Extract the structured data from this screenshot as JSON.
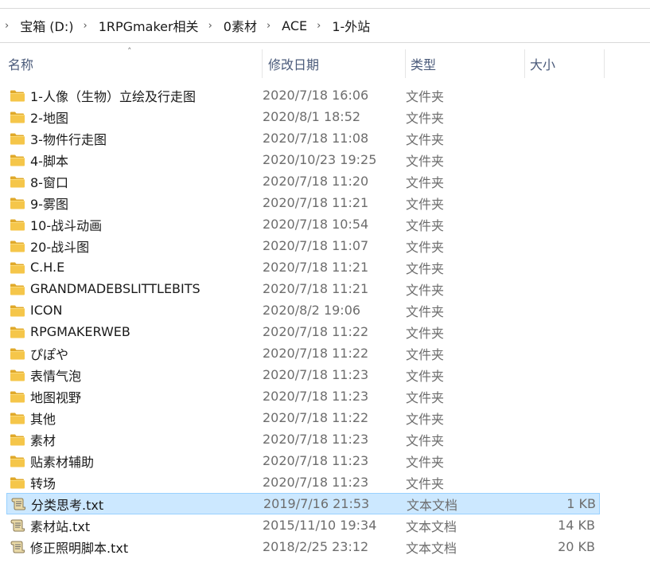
{
  "breadcrumb": {
    "items": [
      "宝箱 (D:)",
      "1RPGmaker相关",
      "0素材",
      "ACE",
      "1-外站"
    ]
  },
  "columns": {
    "name": "名称",
    "date": "修改日期",
    "type": "类型",
    "size": "大小"
  },
  "files": [
    {
      "name": "1-人像（生物）立绘及行走图",
      "date": "2020/7/18 16:06",
      "type": "文件夹",
      "size": "",
      "icon": "folder-icon"
    },
    {
      "name": "2-地图",
      "date": "2020/8/1 18:52",
      "type": "文件夹",
      "size": "",
      "icon": "folder-icon"
    },
    {
      "name": "3-物件行走图",
      "date": "2020/7/18 11:08",
      "type": "文件夹",
      "size": "",
      "icon": "folder-icon"
    },
    {
      "name": "4-脚本",
      "date": "2020/10/23 19:25",
      "type": "文件夹",
      "size": "",
      "icon": "folder-icon"
    },
    {
      "name": "8-窗口",
      "date": "2020/7/18 11:20",
      "type": "文件夹",
      "size": "",
      "icon": "folder-icon"
    },
    {
      "name": "9-雾图",
      "date": "2020/7/18 11:21",
      "type": "文件夹",
      "size": "",
      "icon": "folder-icon"
    },
    {
      "name": "10-战斗动画",
      "date": "2020/7/18 10:54",
      "type": "文件夹",
      "size": "",
      "icon": "folder-icon"
    },
    {
      "name": "20-战斗图",
      "date": "2020/7/18 11:07",
      "type": "文件夹",
      "size": "",
      "icon": "folder-icon"
    },
    {
      "name": "C.H.E",
      "date": "2020/7/18 11:21",
      "type": "文件夹",
      "size": "",
      "icon": "folder-icon"
    },
    {
      "name": "GRANDMADEBSLITTLEBITS",
      "date": "2020/7/18 11:21",
      "type": "文件夹",
      "size": "",
      "icon": "folder-icon"
    },
    {
      "name": "ICON",
      "date": "2020/8/2 19:06",
      "type": "文件夹",
      "size": "",
      "icon": "folder-icon"
    },
    {
      "name": "RPGMAKERWEB",
      "date": "2020/7/18 11:22",
      "type": "文件夹",
      "size": "",
      "icon": "folder-icon"
    },
    {
      "name": "ぴぽや",
      "date": "2020/7/18 11:22",
      "type": "文件夹",
      "size": "",
      "icon": "folder-icon"
    },
    {
      "name": "表情气泡",
      "date": "2020/7/18 11:23",
      "type": "文件夹",
      "size": "",
      "icon": "folder-icon"
    },
    {
      "name": "地图视野",
      "date": "2020/7/18 11:23",
      "type": "文件夹",
      "size": "",
      "icon": "folder-icon"
    },
    {
      "name": "其他",
      "date": "2020/7/18 11:22",
      "type": "文件夹",
      "size": "",
      "icon": "folder-icon"
    },
    {
      "name": "素材",
      "date": "2020/7/18 11:23",
      "type": "文件夹",
      "size": "",
      "icon": "folder-icon"
    },
    {
      "name": "贴素材辅助",
      "date": "2020/7/18 11:23",
      "type": "文件夹",
      "size": "",
      "icon": "folder-icon"
    },
    {
      "name": "转场",
      "date": "2020/7/18 11:23",
      "type": "文件夹",
      "size": "",
      "icon": "folder-icon"
    },
    {
      "name": "分类思考.txt",
      "date": "2019/7/16 21:53",
      "type": "文本文档",
      "size": "1 KB",
      "icon": "text-file-icon",
      "selected": true
    },
    {
      "name": "素材站.txt",
      "date": "2015/11/10 19:34",
      "type": "文本文档",
      "size": "14 KB",
      "icon": "text-file-icon"
    },
    {
      "name": "修正照明脚本.txt",
      "date": "2018/2/25 23:12",
      "type": "文本文档",
      "size": "20 KB",
      "icon": "text-file-icon"
    }
  ],
  "colors": {
    "selected_bg": "#cce8ff",
    "selected_border": "#99d1ff",
    "folder": "#f5c64a",
    "header_text": "#4a5a7a"
  }
}
